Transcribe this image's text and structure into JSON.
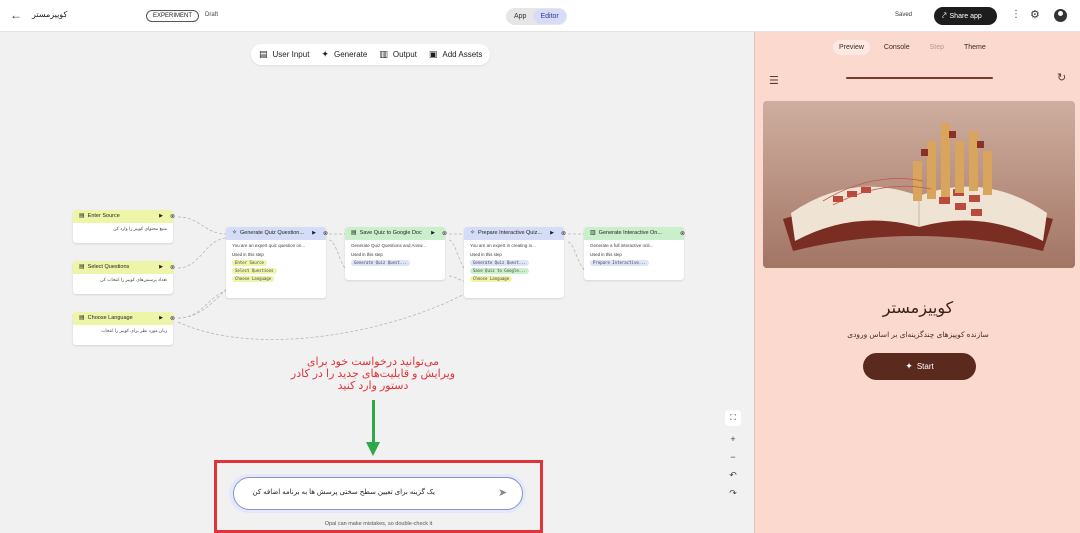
{
  "header": {
    "app_title": "کوییزمستر",
    "experiment_badge": "EXPERIMENT",
    "status": "Draft",
    "modes": [
      "App",
      "Editor"
    ],
    "active_mode": "Editor",
    "saved_label": "Saved",
    "share_label": "Share app"
  },
  "toolbar": {
    "items": [
      {
        "label": "User Input",
        "icon": "user-input-icon"
      },
      {
        "label": "Generate",
        "icon": "sparkle-icon"
      },
      {
        "label": "Output",
        "icon": "output-icon"
      },
      {
        "label": "Add Assets",
        "icon": "add-assets-icon"
      }
    ]
  },
  "nodes": {
    "enter_source": {
      "title": "Enter Source",
      "body": "منبع محتوای کوییز را وارد کن"
    },
    "select_questions": {
      "title": "Select Questions",
      "body": "تعداد پرسش‌های کوییز را انتخاب کن"
    },
    "choose_language": {
      "title": "Choose Language",
      "body": "زبان مورد نظر برای کوییز را انتخاب"
    },
    "generate_quiz": {
      "title": "Generate Quiz Question...",
      "body": "You are an expert quiz question on...",
      "used": "Used in this step",
      "chips": [
        "Enter Source",
        "Select Questions",
        "Choose Language"
      ]
    },
    "save_quiz": {
      "title": "Save Quiz to Google Doc",
      "body": "Generate Quiz Questions and Answ...",
      "used": "Used in this step",
      "chips": [
        "Generate Quiz Quest..."
      ]
    },
    "prepare_quiz": {
      "title": "Prepare Interactive Quiz...",
      "body": "You are an expert in creating in...",
      "used": "Used in this step",
      "chips": [
        "Generate Quiz Quest...",
        "Save Quiz to Google...",
        "Choose Language"
      ]
    },
    "generate_interactive": {
      "title": "Generate Interactive On...",
      "body": "Generate a full interactive onli...",
      "used": "Used in this step",
      "chips": [
        "Prepare Interactive..."
      ]
    }
  },
  "annotation": {
    "lines": [
      "می‌توانید درخواست خود برای",
      "ویرایش و قابلیت‌های جدید را در کادر",
      "دستور وارد کنید"
    ]
  },
  "prompt": {
    "text": "یک گزینه برای تعیین سطح سختی پرسش ها به برنامه اضافه کن",
    "disclaimer": "Opal can make mistakes, so double-check it"
  },
  "preview": {
    "tabs": [
      "Preview",
      "Console",
      "Step",
      "Theme"
    ],
    "active_tab": "Preview",
    "disabled_tab": "Step",
    "title": "کوییزمستر",
    "subtitle": "سازنده کوییزهای چندگزینه‌ای بر اساس ورودی",
    "start_label": "Start"
  },
  "colors": {
    "accent": "#5b2a1f",
    "preview_bg": "#fbd9cf",
    "annotation": "#e0343a",
    "arrow": "#2ea84a"
  }
}
